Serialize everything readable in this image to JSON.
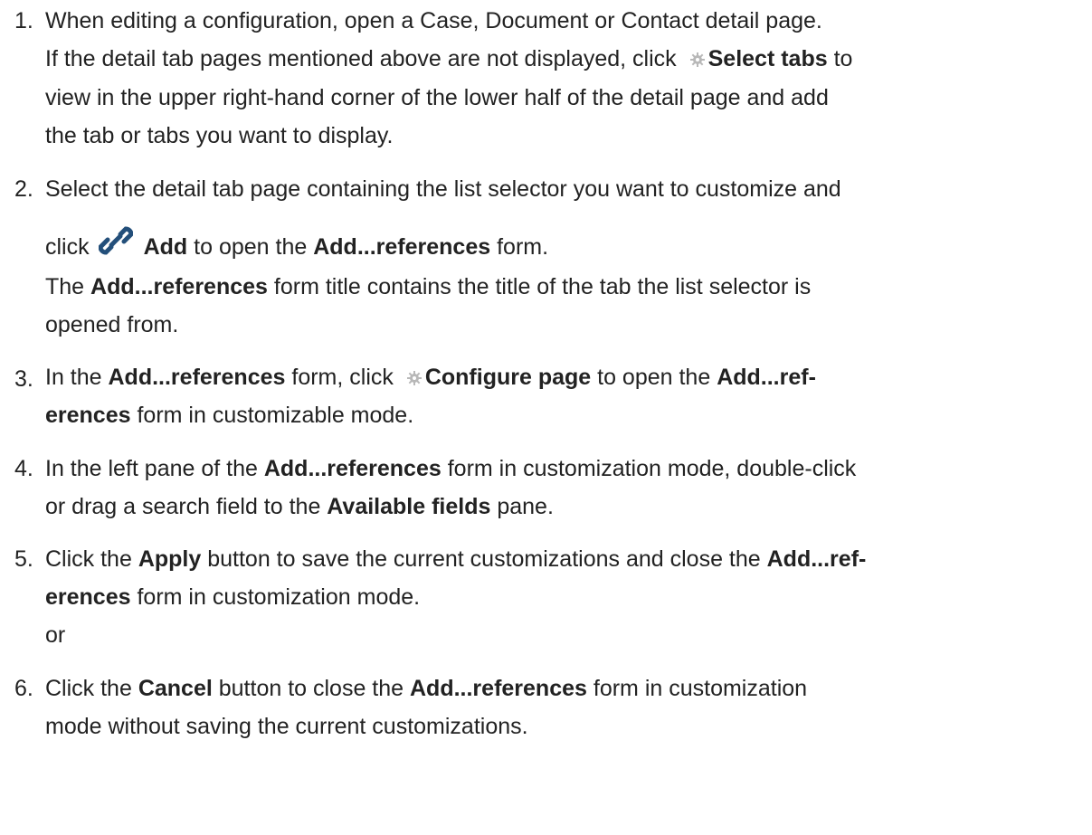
{
  "steps": [
    {
      "number": "1.",
      "l1": "When editing a configuration, open a Case, Document or Contact detail page.",
      "l2_pre": "If the detail tab pages mentioned above are not displayed, click ",
      "l2_icon": "gear-icon",
      "l2_bold": "Select tabs",
      "l2_post": " to",
      "l3": "view in the upper right-hand corner of the lower half of the detail page and add",
      "l4": "the tab or tabs you want to display."
    },
    {
      "number": "2.",
      "l1": "Select the detail tab page containing the list selector you want to customize and",
      "l2_pre": "click",
      "l2_icon": "link-icon",
      "l2_bold": "Add",
      "l2_mid": " to open the ",
      "l2_bold2": "Add...references",
      "l2_post": " form.",
      "l3_pre": "The ",
      "l3_bold": "Add...references",
      "l3_post": " form title contains the title of the tab the list selector is",
      "l4": "opened from."
    },
    {
      "number": "3.",
      "l1_pre": "In the ",
      "l1_bold": "Add...references",
      "l1_mid": " form, click ",
      "l1_icon": "gear-icon",
      "l1_bold2": "Configure page",
      "l1_mid2": " to open the ",
      "l1_bold3": "Add...ref-",
      "l2_bold": "erences",
      "l2_post": " form in customizable mode."
    },
    {
      "number": "4.",
      "l1_pre": "In the left pane of the ",
      "l1_bold": "Add...references",
      "l1_post": " form in customization mode, double-click",
      "l2_pre": "or drag a search field to the ",
      "l2_bold": "Available fields",
      "l2_post": " pane."
    },
    {
      "number": "5.",
      "l1_pre": "Click the ",
      "l1_bold": "Apply",
      "l1_mid": " button to save the current customizations and close the ",
      "l1_bold2": "Add...ref-",
      "l2_bold": "erences",
      "l2_post": " form in customization mode.",
      "l3": "or"
    },
    {
      "number": "6.",
      "l1_pre": "Click the ",
      "l1_bold": "Cancel",
      "l1_mid": " button to close the ",
      "l1_bold2": "Add...references",
      "l1_post": " form in customization",
      "l2": "mode without saving the current customizations."
    }
  ]
}
